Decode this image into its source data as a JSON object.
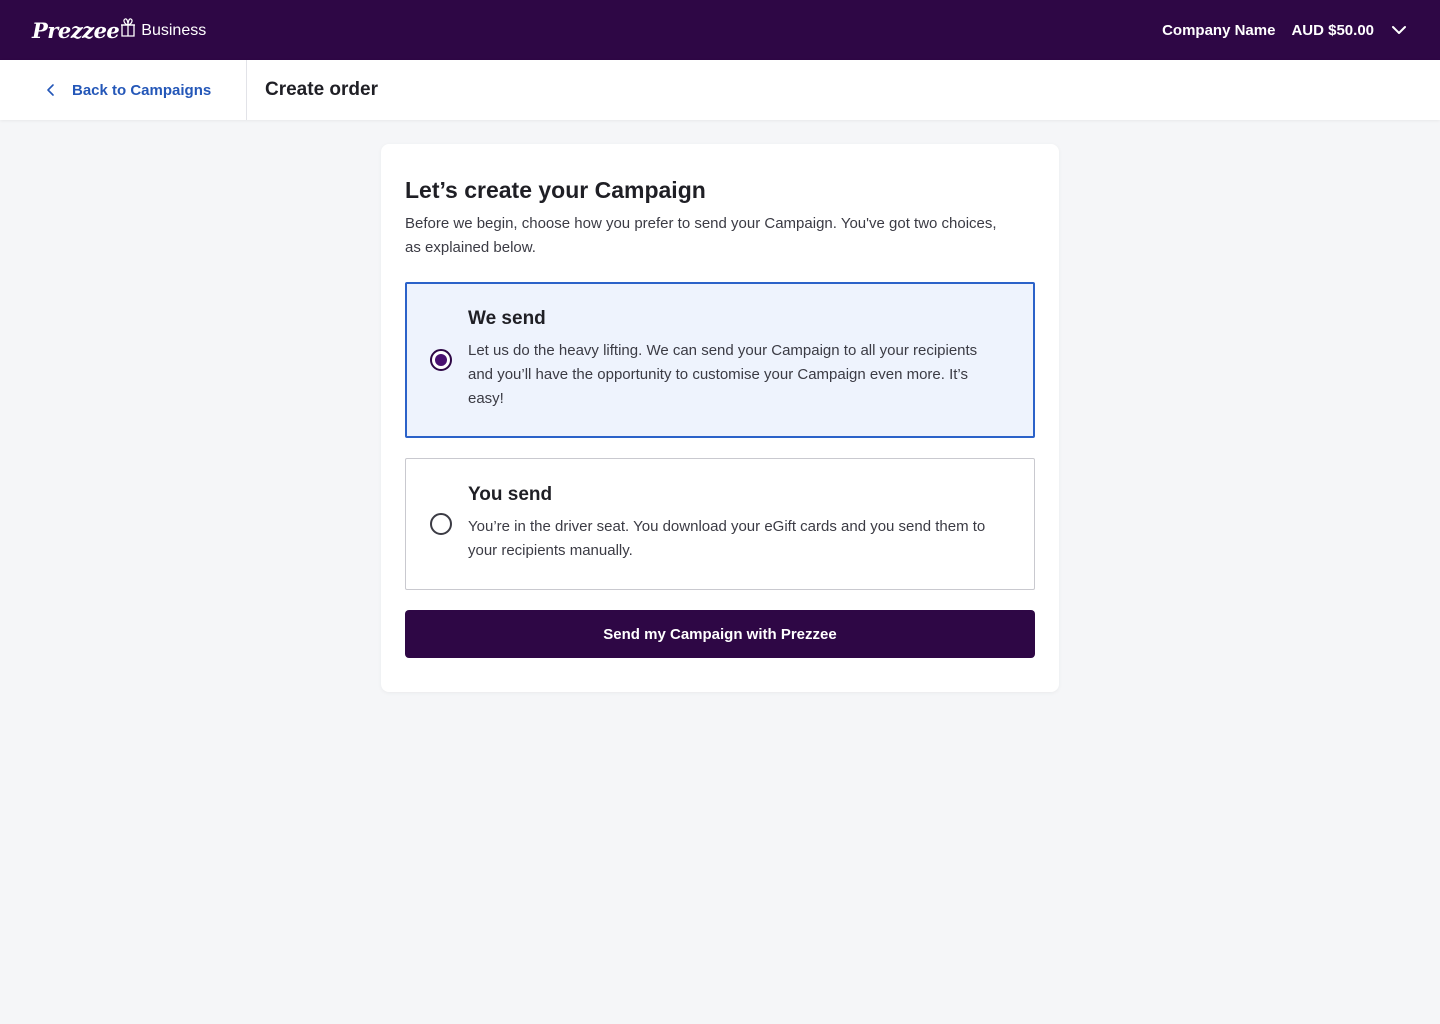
{
  "topbar": {
    "brand_logo": "Prezzee",
    "brand_sub": "Business",
    "company_name": "Company Name",
    "balance": "AUD $50.00"
  },
  "subheader": {
    "back_label": "Back to Campaigns",
    "title": "Create order"
  },
  "card": {
    "title": "Let’s create your Campaign",
    "description": "Before we begin, choose how you prefer to send your Campaign. You've got two choices, as explained below.",
    "options": [
      {
        "title": "We send",
        "description": "Let us do the heavy lifting. We can send your Campaign to all your recipients and you’ll have the opportunity to customise your Campaign even more. It’s easy!",
        "selected": true
      },
      {
        "title": "You send",
        "description": "You’re in the driver seat. You download your eGift cards and you send them to your recipients manually.",
        "selected": false
      }
    ],
    "submit_label": "Send my Campaign with Prezzee"
  },
  "colors": {
    "brand_purple": "#2e0745",
    "link_blue": "#2457b8",
    "selected_border": "#2b62c9",
    "selected_bg": "#eef3fd",
    "page_bg": "#f5f6f8"
  }
}
